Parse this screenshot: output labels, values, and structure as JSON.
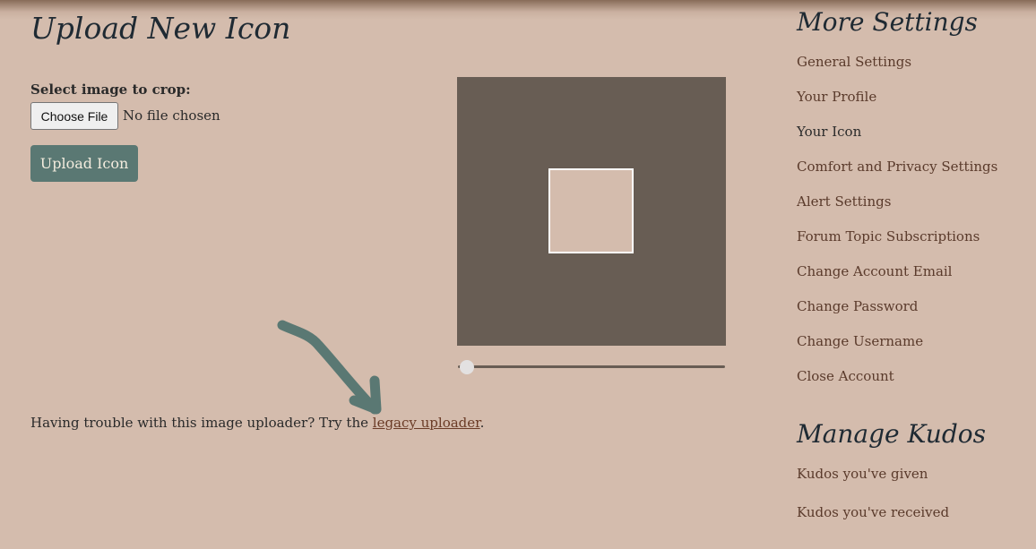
{
  "main": {
    "title": "Upload New Icon",
    "file_label": "Select image to crop:",
    "choose_file_label": "Choose File",
    "no_file_text": "No file chosen",
    "upload_button_label": "Upload Icon",
    "zoom_slider_value": 0,
    "trouble_text": "Having trouble with this image uploader? Try the ",
    "legacy_link_label": "legacy uploader",
    "trouble_suffix": "."
  },
  "sidebar": {
    "settings_title": "More Settings",
    "settings_items": [
      {
        "label": "General Settings"
      },
      {
        "label": "Your Profile"
      },
      {
        "label": "Your Icon",
        "current": true
      },
      {
        "label": "Comfort and Privacy Settings"
      },
      {
        "label": "Alert Settings"
      },
      {
        "label": "Forum Topic Subscriptions"
      },
      {
        "label": "Change Account Email"
      },
      {
        "label": "Change Password"
      },
      {
        "label": "Change Username"
      },
      {
        "label": "Close Account"
      }
    ],
    "kudos_title": "Manage Kudos",
    "kudos_items": [
      {
        "label": "Kudos you've given"
      },
      {
        "label": "Kudos you've received"
      }
    ]
  },
  "colors": {
    "background": "#d4bcad",
    "button": "#5a7873",
    "link": "#5a3a2b",
    "crop_overlay": "#685d54",
    "annotation_arrow": "#5a7873"
  }
}
